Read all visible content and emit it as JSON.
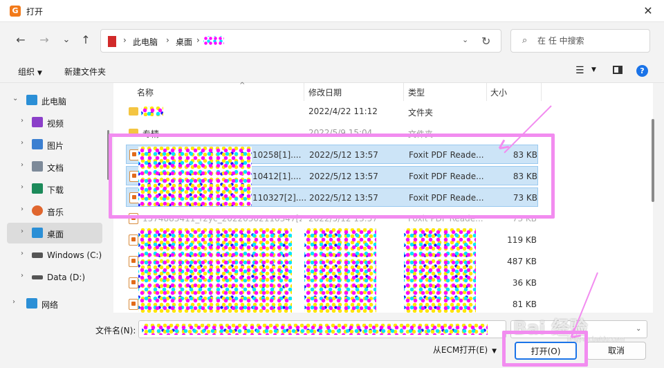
{
  "window": {
    "title": "打开",
    "app_icon_letter": "G",
    "close_glyph": "✕"
  },
  "nav": {
    "back_glyph": "←",
    "forward_glyph": "→",
    "recent_glyph": "⌄",
    "up_glyph": "↑",
    "breadcrumb": [
      "此电脑",
      "桌面"
    ],
    "sep_glyph": "›",
    "dropdown_glyph": "⌄",
    "refresh_glyph": "↻",
    "search_placeholder": "在 任 中搜索",
    "search_glyph": "⌕"
  },
  "toolbar": {
    "organize_label": "组织",
    "new_folder_label": "新建文件夹",
    "view_glyph": "☰",
    "help_glyph": "?"
  },
  "sidebar": {
    "items": [
      {
        "label": "此电脑",
        "icon": "computer-icon",
        "color": "#2b8fd6",
        "expanded": true
      },
      {
        "label": "视频",
        "icon": "video-icon",
        "color": "#8b3fc9"
      },
      {
        "label": "图片",
        "icon": "picture-icon",
        "color": "#3b7fd1"
      },
      {
        "label": "文档",
        "icon": "document-icon",
        "color": "#7d8a99"
      },
      {
        "label": "下载",
        "icon": "download-icon",
        "color": "#1c8a5a"
      },
      {
        "label": "音乐",
        "icon": "music-icon",
        "color": "#e0662e"
      },
      {
        "label": "桌面",
        "icon": "desktop-icon",
        "color": "#2b8fd6",
        "selected": true
      },
      {
        "label": "Windows (C:)",
        "icon": "drive-icon",
        "color": "#555555"
      },
      {
        "label": "Data (D:)",
        "icon": "drive-icon",
        "color": "#555555"
      },
      {
        "label": "网络",
        "icon": "network-icon",
        "color": "#2b8fd6"
      }
    ]
  },
  "columns": {
    "name": "名称",
    "date": "修改日期",
    "type": "类型",
    "size": "大小"
  },
  "files": [
    {
      "name": "",
      "date": "2022/4/22 11:12",
      "type": "文件夹",
      "size": "",
      "kind": "folder"
    },
    {
      "name": "专精",
      "date": "2022/5/9 15:04",
      "type": "文件夹",
      "size": "",
      "kind": "folder"
    },
    {
      "name": "10258[1]....",
      "date": "2022/5/12 13:57",
      "type": "Foxit PDF Reade...",
      "size": "83 KB",
      "kind": "pdf",
      "selected": true
    },
    {
      "name": "10412[1]....",
      "date": "2022/5/12 13:57",
      "type": "Foxit PDF Reade...",
      "size": "83 KB",
      "kind": "pdf",
      "selected": true
    },
    {
      "name": "110327[2]....",
      "date": "2022/5/12 13:57",
      "type": "Foxit PDF Reade...",
      "size": "73 KB",
      "kind": "pdf",
      "selected": true
    },
    {
      "name": "1574883411_r2yc_20220502110347[2]....",
      "date": "2022/5/12 13:57",
      "type": "Foxit PDF Reade...",
      "size": "73 KB",
      "kind": "pdf"
    },
    {
      "name": "",
      "date": "",
      "type": "",
      "size": "119 KB",
      "kind": "pdf"
    },
    {
      "name": "",
      "date": "",
      "type": "",
      "size": "487 KB",
      "kind": "pdf"
    },
    {
      "name": "",
      "date": "",
      "type": "",
      "size": "36 KB",
      "kind": "pdf"
    },
    {
      "name": "",
      "date": "",
      "type": "",
      "size": "81 KB",
      "kind": "pdf"
    }
  ],
  "bottom": {
    "filename_label": "文件名(N):",
    "filter_text": "",
    "open_ecm_label": "从ECM打开(E)",
    "open_label": "打开(O)",
    "cancel_label": "取消",
    "dropdown_glyph": "⌄",
    "watermark": "Bai 经验",
    "watermark_sub": "jingyan.baidu.com"
  },
  "colors": {
    "highlight": "#f28cf0",
    "selection": "#cce4f7",
    "accent": "#1a73e8"
  }
}
